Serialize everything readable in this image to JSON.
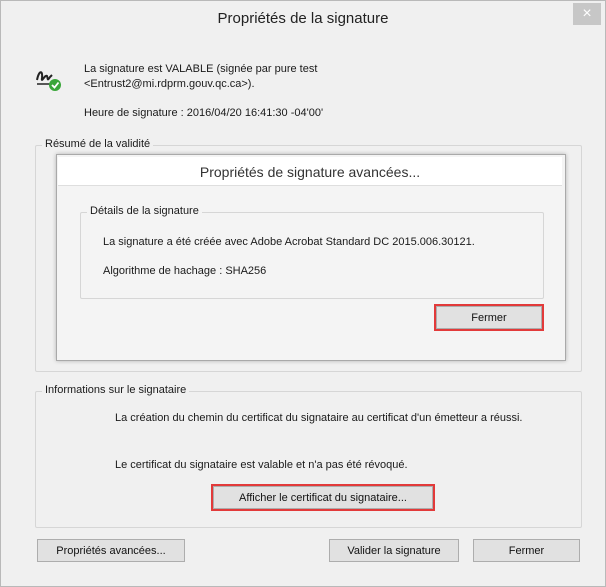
{
  "window": {
    "title": "Propriétés de la signature",
    "close_glyph": "×"
  },
  "signature": {
    "status": "La signature est VALABLE (signée par pure test <Entrust2@mi.rdprm.gouv.qc.ca>).",
    "time_label": "Heure de signature :",
    "time_value": "2016/04/20 16:41:30 -04'00'"
  },
  "validity_summary": {
    "label": "Résumé de la validité",
    "advanced_panel": {
      "title": "Propriétés de signature avancées...",
      "details_label": "Détails de la signature",
      "created_with": "La signature a été créée avec Adobe Acrobat Standard DC 2015.006.30121.",
      "hash_label": "Algorithme de hachage :",
      "hash_value": "SHA256",
      "close_label": "Fermer"
    }
  },
  "signer_info": {
    "label": "Informations sur le signataire",
    "path_text": "La création du chemin du certificat du signataire au certificat d'un émetteur a réussi.",
    "valid_text": "Le certificat du signataire est valable et n'a pas été révoqué.",
    "show_cert_label": "Afficher le certificat du signataire..."
  },
  "footer": {
    "advanced_props_label": "Propriétés avancées...",
    "validate_label": "Valider la signature",
    "close_label": "Fermer"
  },
  "icons": {
    "status_icon": "signature-valid-icon",
    "close_icon": "close-icon"
  },
  "colors": {
    "highlight": "#e23a3a",
    "valid_check": "#3aa63a"
  }
}
